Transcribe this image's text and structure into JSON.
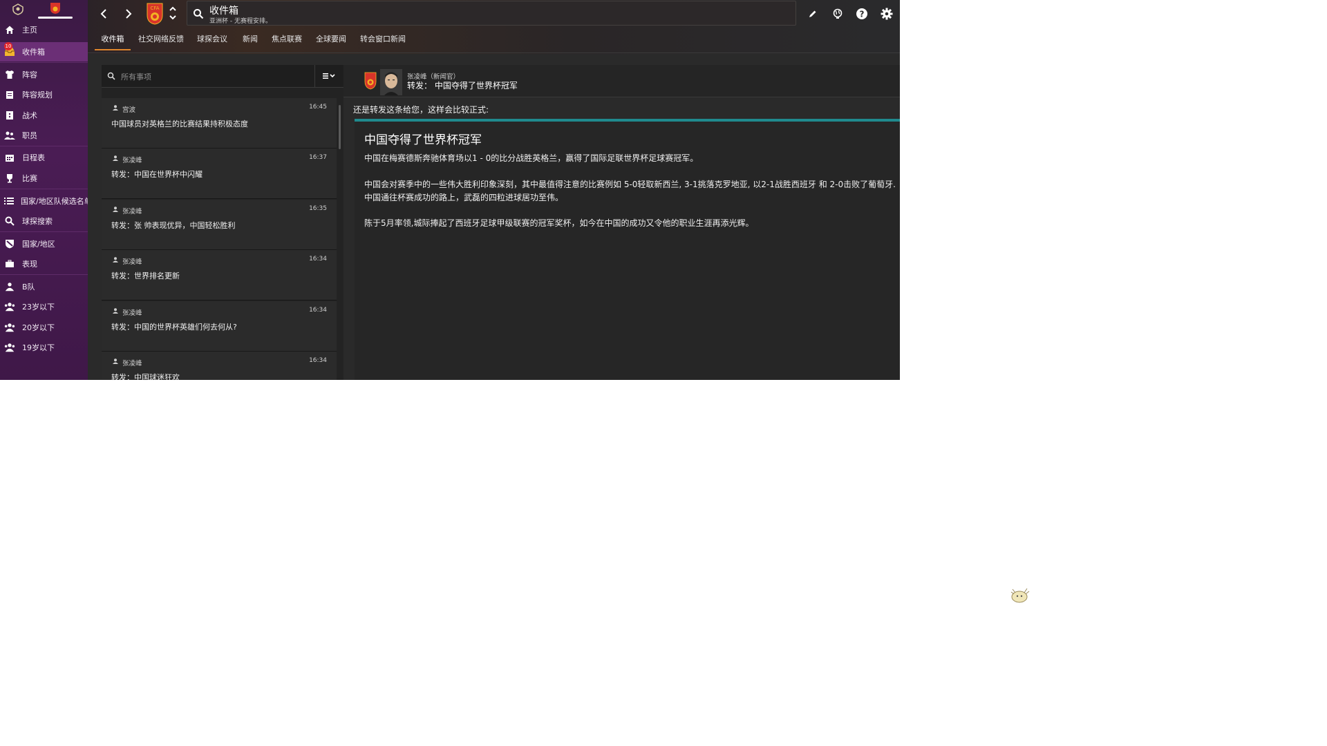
{
  "colors": {
    "sidebar_bg": "#3f1848",
    "sidebar_active": "#6b2f76",
    "accent_tab": "#e0862c",
    "article_bar": "#1f8a8e",
    "badge": "#e0262c"
  },
  "sidebar": {
    "items": [
      {
        "label": "主页",
        "icon": "home-icon"
      },
      {
        "label": "收件箱",
        "icon": "inbox-icon",
        "badge": "10"
      },
      {
        "label": "阵容",
        "icon": "shirt-icon"
      },
      {
        "label": "阵容规划",
        "icon": "clipboard-icon"
      },
      {
        "label": "战术",
        "icon": "tactics-icon"
      },
      {
        "label": "职员",
        "icon": "staff-icon"
      },
      {
        "label": "日程表",
        "icon": "calendar-icon"
      },
      {
        "label": "比赛",
        "icon": "trophy-icon"
      },
      {
        "label": "国家/地区队候选名单",
        "icon": "list-icon"
      },
      {
        "label": "球探搜索",
        "icon": "search-icon"
      },
      {
        "label": "国家/地区",
        "icon": "shield-icon"
      },
      {
        "label": "表现",
        "icon": "briefcase-icon"
      },
      {
        "label": "B队",
        "icon": "team-icon"
      },
      {
        "label": "23岁以下",
        "icon": "team-icon"
      },
      {
        "label": "20岁以下",
        "icon": "team-icon"
      },
      {
        "label": "19岁以下",
        "icon": "team-icon"
      }
    ]
  },
  "header": {
    "search_title": "收件箱",
    "search_subtitle": "亚洲杯 - 无赛程安排。",
    "crest_text": "CFA",
    "tabs": [
      "收件箱",
      "社交网络反馈",
      "球探会议",
      "新闻",
      "焦点联赛",
      "全球要闻",
      "转会窗口新闻"
    ]
  },
  "inbox": {
    "search_placeholder": "所有事项",
    "messages": [
      {
        "from": "宫波",
        "time": "16:45",
        "subject": "中国球员对英格兰的比赛结果持积极态度"
      },
      {
        "from": "张凌峰",
        "time": "16:37",
        "subject": "转发：中国在世界杯中闪耀"
      },
      {
        "from": "张凌峰",
        "time": "16:35",
        "subject": "转发：张 帅表现优异，中国轻松胜利"
      },
      {
        "from": "张凌峰",
        "time": "16:34",
        "subject": "转发：世界排名更新"
      },
      {
        "from": "张凌峰",
        "time": "16:34",
        "subject": "转发：中国的世界杯英雄们何去何从?"
      },
      {
        "from": "张凌峰",
        "time": "16:34",
        "subject": "转发：中国球迷狂欢"
      }
    ]
  },
  "reader": {
    "sender": "张凌峰（新闻官）",
    "subject": "转发：  中国夺得了世界杯冠军",
    "intro": "还是转发这条给您，这样会比较正式:",
    "article_title": "中国夺得了世界杯冠军",
    "paragraphs": [
      "中国在梅赛德斯奔驰体育场以1 - 0的比分战胜英格兰，赢得了国际足联世界杯足球赛冠军。",
      "中国会对赛季中的一些伟大胜利印象深刻，其中最值得注意的比赛例如 5-0轻取新西兰, 3-1挑落克罗地亚, 以2-1战胜西班牙 和 2-0击败了葡萄牙.",
      "中国通往杯赛成功的路上，武磊的四粒进球居功至伟。",
      "陈于5月率领,城际捧起了西班牙足球甲级联赛的冠军奖杯，如今在中国的成功又令他的职业生涯再添光辉。"
    ]
  }
}
